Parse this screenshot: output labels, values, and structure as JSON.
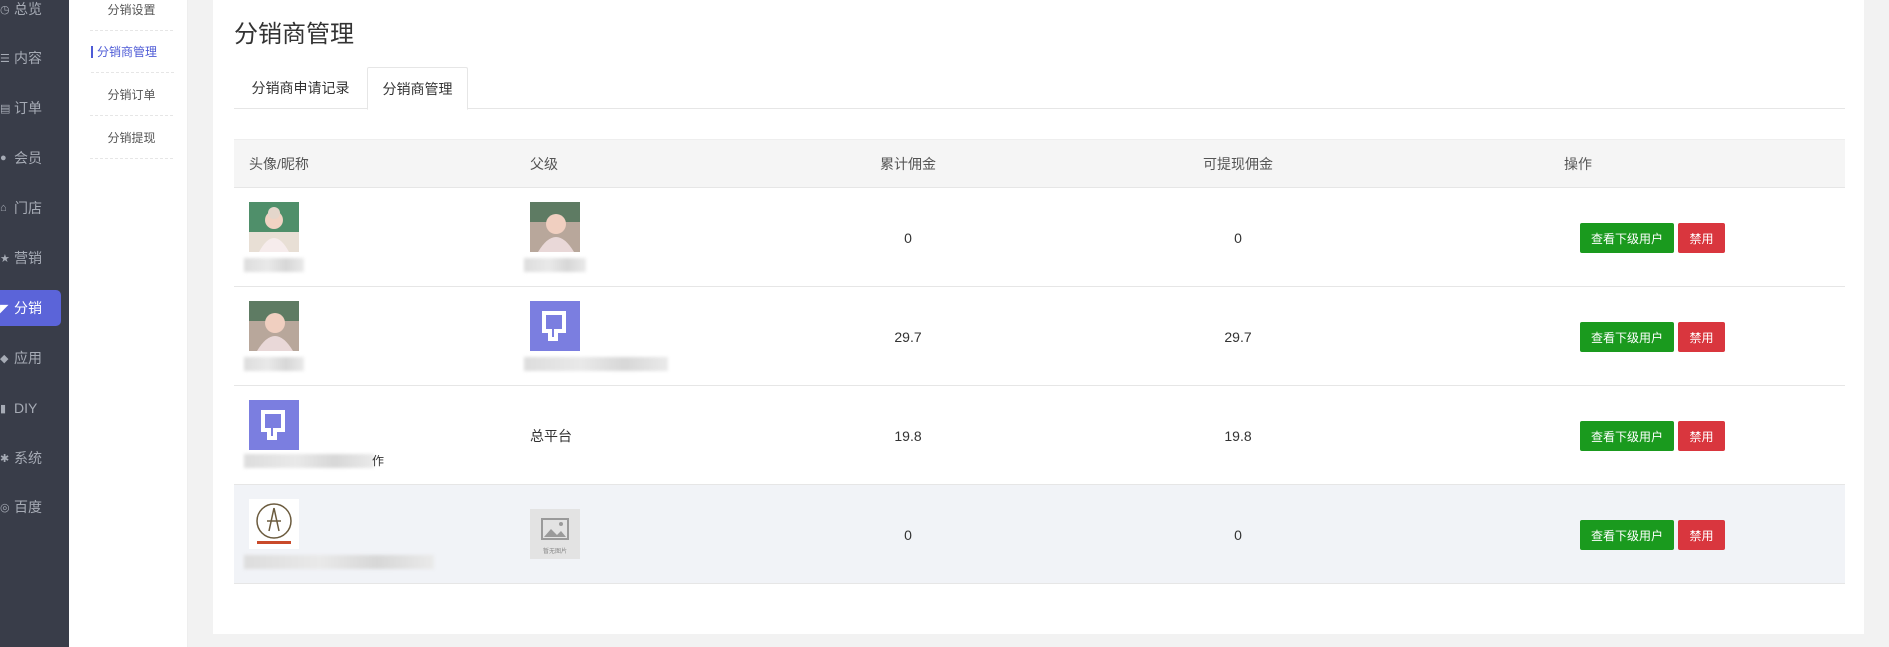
{
  "nav": {
    "items": [
      {
        "label": "总览",
        "icon": "dashboard-icon"
      },
      {
        "label": "内容",
        "icon": "list-icon"
      },
      {
        "label": "订单",
        "icon": "order-icon"
      },
      {
        "label": "会员",
        "icon": "member-icon"
      },
      {
        "label": "门店",
        "icon": "store-icon"
      },
      {
        "label": "营销",
        "icon": "marketing-icon"
      },
      {
        "label": "分销",
        "icon": "distribution-icon"
      },
      {
        "label": "应用",
        "icon": "app-icon"
      },
      {
        "label": "DIY",
        "icon": "diy-icon"
      },
      {
        "label": "系统",
        "icon": "gear-icon"
      },
      {
        "label": "百度",
        "icon": "baidu-icon"
      }
    ],
    "active": "分销",
    "active_color": "#5b64d9"
  },
  "subnav": {
    "items": [
      "分销设置",
      "分销商管理",
      "分销订单",
      "分销提现"
    ],
    "active": "分销商管理"
  },
  "page": {
    "title": "分销商管理",
    "tabs": [
      "分销商申请记录",
      "分销商管理"
    ],
    "active_tab": "分销商管理"
  },
  "table": {
    "columns": [
      "头像/昵称",
      "父级",
      "累计佣金",
      "可提现佣金",
      "操作"
    ],
    "rows": [
      {
        "avatar": "photo-baby-1",
        "nickname": "",
        "parent": "",
        "parent_avatar": "photo-baby-2",
        "total_commission": "0",
        "withdrawable": "0"
      },
      {
        "avatar": "photo-baby-2",
        "nickname": "",
        "parent": "",
        "parent_avatar": "logo-purple",
        "total_commission": "29.7",
        "withdrawable": "29.7"
      },
      {
        "avatar": "logo-purple",
        "nickname": "作",
        "parent": "总平台",
        "parent_avatar": "",
        "total_commission": "19.8",
        "withdrawable": "19.8"
      },
      {
        "avatar": "logo-seal",
        "nickname": "",
        "parent": "",
        "parent_avatar": "no-image",
        "total_commission": "0",
        "withdrawable": "0"
      }
    ],
    "actions": {
      "view": "查看下级用户",
      "ban": "禁用"
    },
    "colors": {
      "view": "#1a9a1e",
      "ban": "#d9363e"
    }
  },
  "placeholder_image": {
    "label": "暂无图片"
  }
}
